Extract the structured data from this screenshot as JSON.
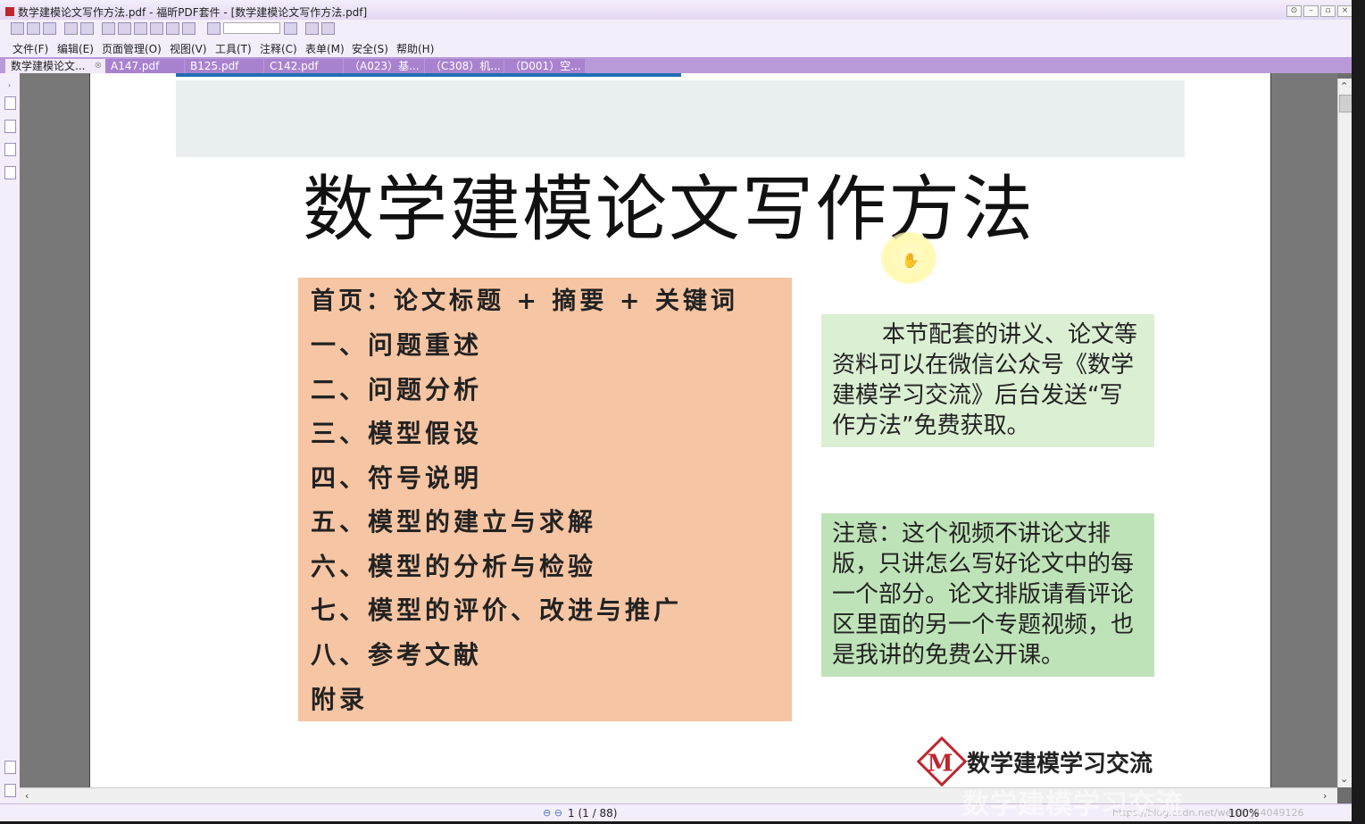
{
  "window": {
    "title": "数学建模论文写作方法.pdf - 福昕PDF套件 - [数学建模论文写作方法.pdf]",
    "controls": [
      "⊙",
      "–",
      "▫",
      "×"
    ]
  },
  "menu": [
    "文件(F)",
    "编辑(E)",
    "页面管理(O)",
    "视图(V)",
    "工具(T)",
    "注释(C)",
    "表单(M)",
    "安全(S)",
    "帮助(H)"
  ],
  "tabs": [
    {
      "label": "数学建模论文..."
    },
    {
      "label": "A147.pdf"
    },
    {
      "label": "B125.pdf"
    },
    {
      "label": "C142.pdf"
    },
    {
      "label": "（A023）基..."
    },
    {
      "label": "（C308）机..."
    },
    {
      "label": "（D001）空..."
    }
  ],
  "document": {
    "title": "数学建模论文写作方法",
    "toc_heading": "首页：论文标题 + 摘要 + 关键词",
    "toc_items": [
      "一、问题重述",
      "二、问题分析",
      "三、模型假设",
      "四、符号说明",
      "五、模型的建立与求解",
      "六、模型的分析与检验",
      "七、模型的评价、改进与推广",
      "八、参考文献",
      "附录"
    ],
    "note1": "本节配套的讲义、论文等资料可以在微信公众号《数学建模学习交流》后台发送“写作方法”免费获取。",
    "note2": "注意：这个视频不讲论文排版，只讲怎么写好论文中的每一个部分。论文排版请看评论区里面的另一个专题视频，也是我讲的免费公开课。",
    "brand_logo": "M",
    "brand_text": "数学建模学习交流"
  },
  "status": {
    "page_info": "1 (1 / 88)",
    "zoom": "100%",
    "url": "https://blog.csdn.net/weixin_44049126",
    "nav_icons": "⊖ ⊖"
  },
  "watermark": "数学建模学习交流"
}
